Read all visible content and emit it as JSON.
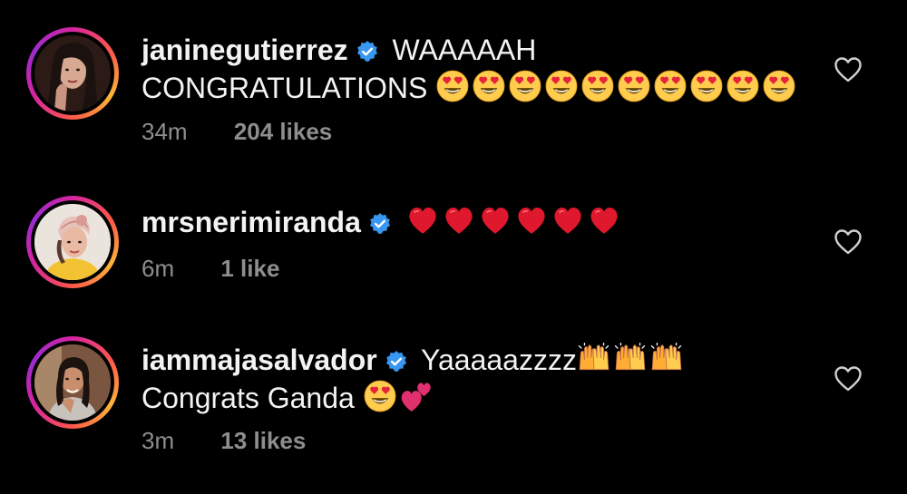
{
  "comments": [
    {
      "username": "janinegutierrez",
      "verified": true,
      "text": "WAAAAAH CONGRATULATIONS",
      "emoji": [
        "heart-eyes-emoji",
        "heart-eyes-emoji",
        "heart-eyes-emoji",
        "heart-eyes-emoji",
        "heart-eyes-emoji",
        "heart-eyes-emoji",
        "heart-eyes-emoji",
        "heart-eyes-emoji",
        "heart-eyes-emoji",
        "heart-eyes-emoji"
      ],
      "time": "34m",
      "likes": "204 likes"
    },
    {
      "username": "mrsnerimiranda",
      "verified": true,
      "text": "",
      "emoji": [
        "red-heart-emoji",
        "red-heart-emoji",
        "red-heart-emoji",
        "red-heart-emoji",
        "red-heart-emoji",
        "red-heart-emoji"
      ],
      "time": "6m",
      "likes": "1 like"
    },
    {
      "username": "iammajasalvador",
      "verified": true,
      "text": "Yaaaaazzzz",
      "text2": "Congrats Ganda",
      "emoji": [
        "raising-hands-emoji",
        "raising-hands-emoji",
        "raising-hands-emoji"
      ],
      "emoji2": [
        "heart-eyes-emoji",
        "two-hearts-emoji"
      ],
      "time": "3m",
      "likes": "13 likes"
    }
  ],
  "colors": {
    "background": "#000000",
    "text": "#f3f3f3",
    "meta": "#8e8e8e",
    "verified": "#3897f0",
    "heart_icon": "#d0d0d0"
  }
}
